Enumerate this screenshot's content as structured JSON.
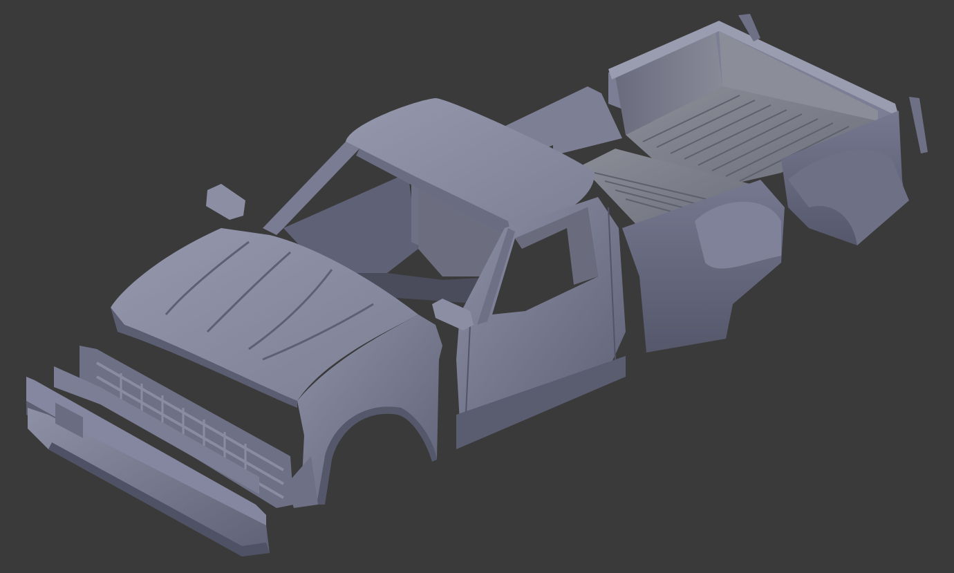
{
  "viewport": {
    "background_color": "#3a3a3a",
    "model_color": "#7a7c93",
    "model_shadow_color": "#55576a",
    "model_highlight_color": "#9a9cb2",
    "bed_floor_color": "#85878f"
  },
  "model": {
    "parts": [
      "roof-panel",
      "cab-back-panel",
      "windshield-frame",
      "hood-panel",
      "left-mirror",
      "right-mirror",
      "front-fender",
      "door-panel",
      "rocker-panel",
      "truck-bed",
      "bed-floor",
      "bed-side-panel",
      "rear-fender-flare",
      "tailgate-hinge",
      "grille",
      "front-bumper",
      "lower-valance"
    ]
  }
}
